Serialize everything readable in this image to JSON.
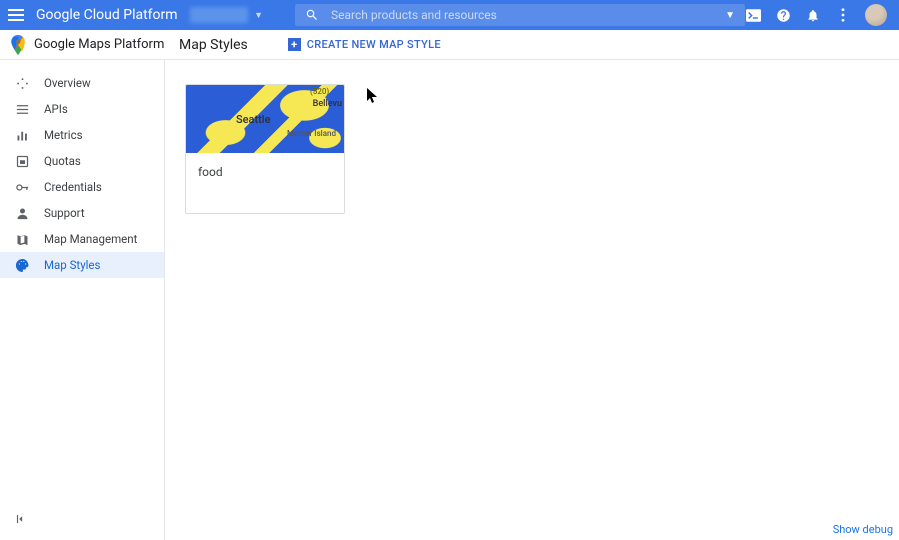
{
  "header": {
    "gcp_title": "Google Cloud Platform",
    "search_placeholder": "Search products and resources"
  },
  "subheader": {
    "platform_title": "Google Maps Platform",
    "page_title": "Map Styles",
    "create_label": "CREATE NEW MAP STYLE"
  },
  "sidebar": {
    "items": [
      {
        "label": "Overview",
        "icon": "overview"
      },
      {
        "label": "APIs",
        "icon": "apis"
      },
      {
        "label": "Metrics",
        "icon": "metrics"
      },
      {
        "label": "Quotas",
        "icon": "quotas"
      },
      {
        "label": "Credentials",
        "icon": "credentials"
      },
      {
        "label": "Support",
        "icon": "support"
      },
      {
        "label": "Map Management",
        "icon": "mapmgmt"
      },
      {
        "label": "Map Styles",
        "icon": "mapstyles",
        "active": true
      }
    ]
  },
  "card": {
    "name": "food",
    "thumb_labels": {
      "seattle": "Seattle",
      "bellevue": "Bellevu",
      "mercer": "Mercer Island",
      "route": "(520)"
    }
  },
  "footer": {
    "show_debug": "Show debug"
  }
}
